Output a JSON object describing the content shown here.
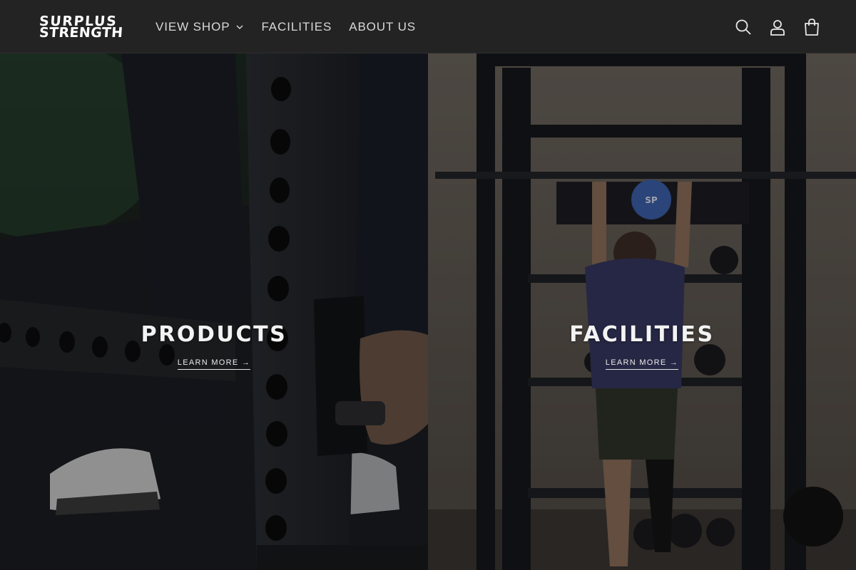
{
  "header": {
    "logo": {
      "line1": "SURPLUS",
      "line2": "STRENGTH"
    },
    "nav": [
      {
        "label": "VIEW SHOP",
        "has_dropdown": true
      },
      {
        "label": "FACILITIES"
      },
      {
        "label": "ABOUT US"
      }
    ],
    "icons": [
      "search-icon",
      "account-icon",
      "cart-icon"
    ]
  },
  "panels": [
    {
      "title": "PRODUCTS",
      "link": "LEARN MORE →"
    },
    {
      "title": "FACILITIES",
      "link": "LEARN MORE →"
    }
  ],
  "colors": {
    "header_bg": "#232323",
    "text": "#ffffff",
    "nav_text": "#d8d8d8"
  }
}
